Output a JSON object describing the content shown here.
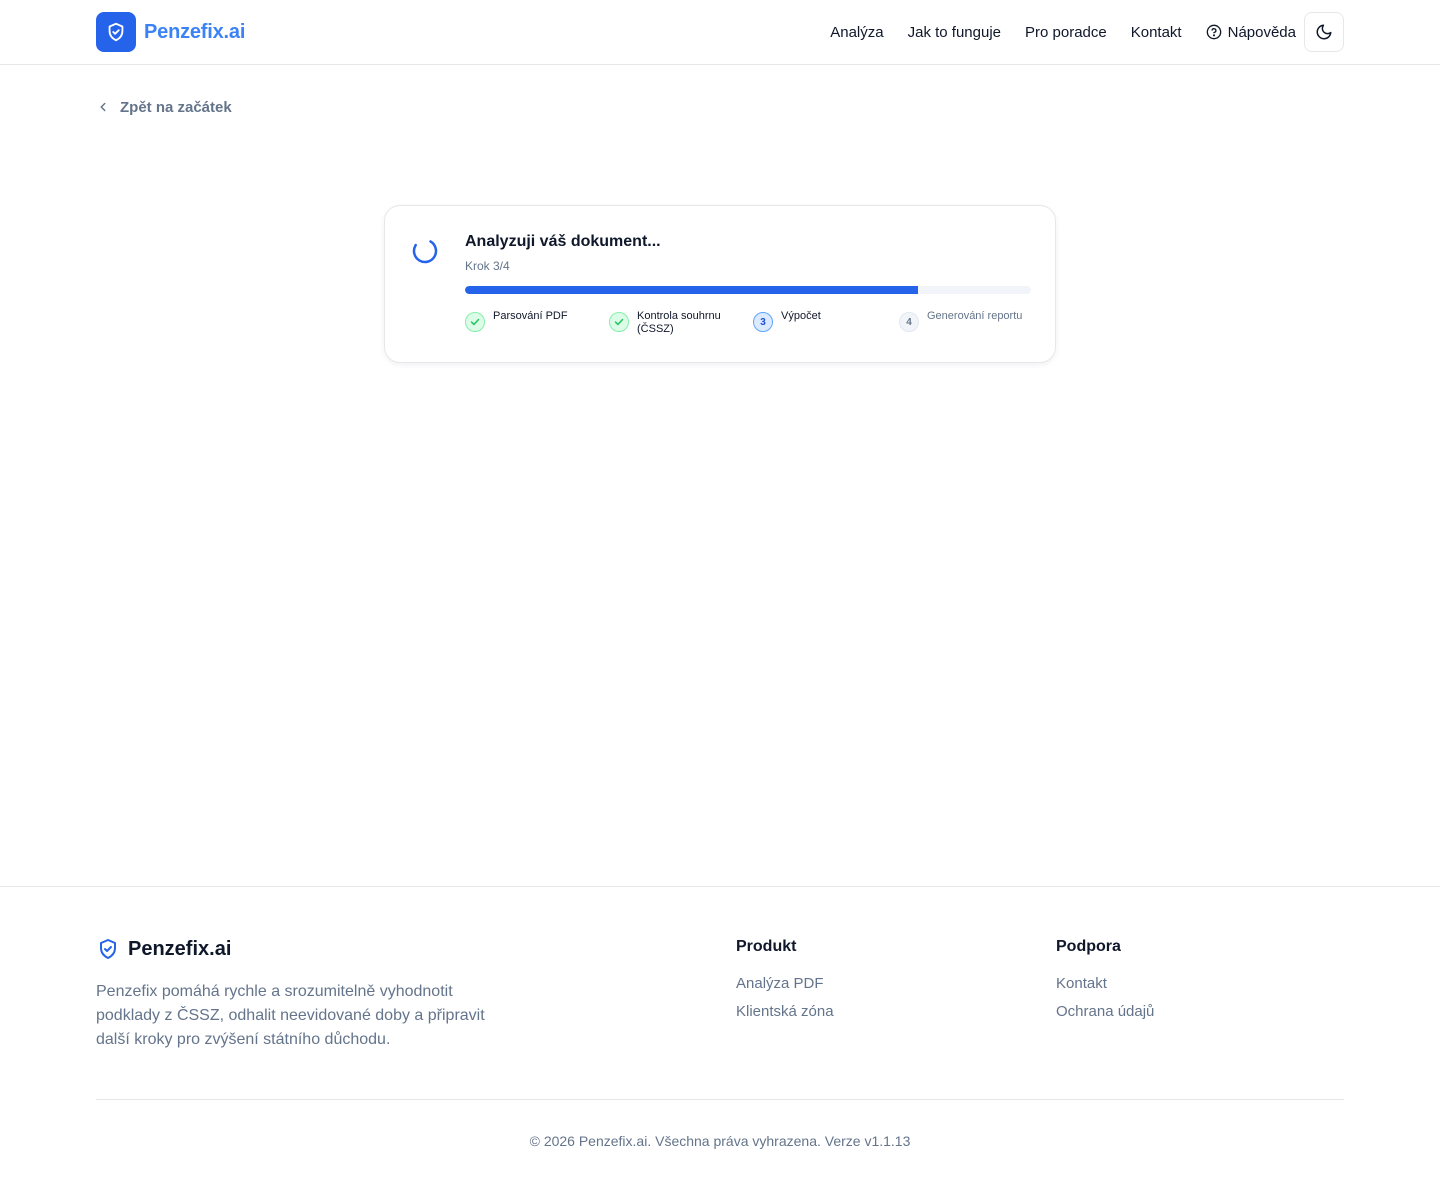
{
  "brand": {
    "name": "Penzefix.ai",
    "accent": "#2563eb",
    "logo_icon": "shield-check-icon"
  },
  "nav": {
    "links": [
      "Analýza",
      "Jak to funguje",
      "Pro poradce",
      "Kontakt"
    ],
    "help_label": "Nápověda",
    "help_icon": "question-circle-icon",
    "theme_icon": "moon-icon"
  },
  "back_link": {
    "label": "Zpět na začátek",
    "icon": "chevron-left-icon"
  },
  "analysis": {
    "title": "Analyzuji váš dokument...",
    "step_text": "Krok 3/4",
    "progress": 0.8,
    "steps": [
      {
        "label": "Parsování PDF",
        "status": "done"
      },
      {
        "label": "Kontrola souhrnu (ČSSZ)",
        "status": "done"
      },
      {
        "label": "Výpočet",
        "status": "active",
        "number": "3"
      },
      {
        "label": "Generování reportu",
        "status": "pending",
        "number": "4"
      }
    ]
  },
  "footer": {
    "brand_name": "Penzefix.ai",
    "description": "Penzefix pomáhá rychle a srozumitelně vyhodnotit podklady z ČSSZ, odhalit neevidované doby a připravit další kroky pro zvýšení státního důchodu.",
    "columns": [
      {
        "title": "Produkt",
        "links": [
          "Analýza PDF",
          "Klientská zóna"
        ]
      },
      {
        "title": "Podpora",
        "links": [
          "Kontakt",
          "Ochrana údajů"
        ]
      }
    ],
    "copyright": "© 2026 Penzefix.ai. Všechna práva vyhrazena. Verze v1.1.13"
  }
}
